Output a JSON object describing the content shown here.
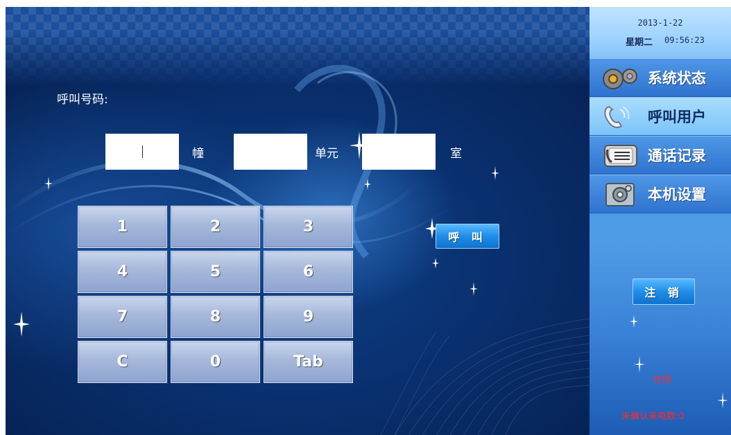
{
  "main": {
    "call_number_label": "呼叫号码:",
    "building": {
      "value": "",
      "unit_label": "幢"
    },
    "unit": {
      "value": "",
      "unit_label": "单元"
    },
    "room": {
      "value": "",
      "unit_label": "室"
    },
    "keypad": [
      "1",
      "2",
      "3",
      "4",
      "5",
      "6",
      "7",
      "8",
      "9",
      "C",
      "0",
      "Tab"
    ],
    "call_button": "呼 叫"
  },
  "sidebar": {
    "date": "2013-1-22",
    "weekday": "星期二",
    "time": "09:56:23",
    "menu": [
      {
        "label": "系统状态",
        "icon": "gears-icon",
        "active": false
      },
      {
        "label": "呼叫用户",
        "icon": "phone-icon",
        "active": true
      },
      {
        "label": "通话记录",
        "icon": "call-log-icon",
        "active": false
      },
      {
        "label": "本机设置",
        "icon": "settings-icon",
        "active": false
      }
    ],
    "logout_button": "注 销",
    "status_online": "在线",
    "unconfirmed_calls": "未确认来电数:0"
  },
  "colors": {
    "background_dark": "#082b66",
    "key_face": "#a6b8da",
    "button_blue": "#1f8ee8",
    "active_menu": "#7cc4f8",
    "status_red": "#ff2a2a"
  }
}
